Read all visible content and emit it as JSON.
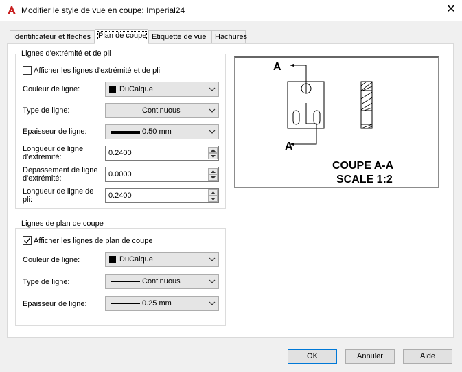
{
  "window": {
    "title": "Modifier le style de vue en coupe: Imperial24",
    "app_icon": "autocad-a-icon",
    "accent": "#c81e1e"
  },
  "tabs": [
    {
      "label": "Identificateur et flèches"
    },
    {
      "label": "Plan de coupe",
      "active": true
    },
    {
      "label": "Etiquette de vue"
    },
    {
      "label": "Hachures"
    }
  ],
  "group1": {
    "title": "Lignes d'extrémité et de pli",
    "checkbox_label": "Afficher les lignes d'extrémité et de pli",
    "checked": false,
    "color_label": "Couleur de ligne:",
    "color_value": "DuCalque",
    "linetype_label": "Type de ligne:",
    "linetype_value": "Continuous",
    "lineweight_label": "Epaisseur de ligne:",
    "lineweight_value": "0.50 mm",
    "end_length_label_1": "Longueur de ligne",
    "end_length_label_2": "d'extrémité:",
    "end_length_value": "0.2400",
    "overshoot_label_1": "Dépassement de ligne",
    "overshoot_label_2": "d'extrémité:",
    "overshoot_value": "0.0000",
    "bend_length_label_1": "Longueur de ligne de",
    "bend_length_label_2": "pli:",
    "bend_length_value": "0.2400"
  },
  "group2": {
    "title": "Lignes de plan de coupe",
    "checkbox_label": "Afficher les lignes de plan de coupe",
    "checked": true,
    "color_label": "Couleur de ligne:",
    "color_value": "DuCalque",
    "linetype_label": "Type de ligne:",
    "linetype_value": "Continuous",
    "lineweight_label": "Epaisseur de ligne:",
    "lineweight_value": "0.25 mm"
  },
  "preview": {
    "label_top": "A",
    "label_bottom": "A",
    "caption_line1": "COUPE A-A",
    "caption_line2": "SCALE 1:2"
  },
  "buttons": {
    "ok": "OK",
    "cancel": "Annuler",
    "help": "Aide"
  }
}
